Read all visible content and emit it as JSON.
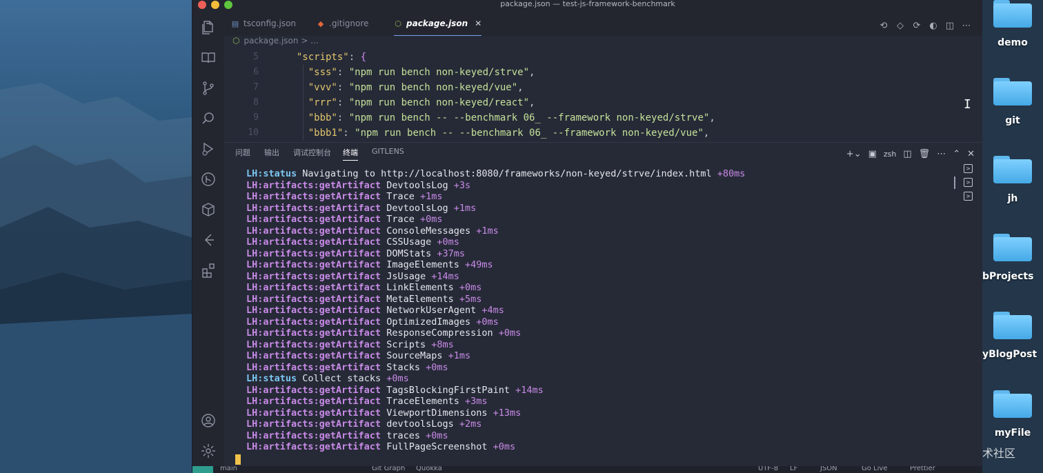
{
  "window": {
    "title": "package.json — test-js-framework-benchmark"
  },
  "tabs": [
    {
      "label": "tsconfig.json",
      "icon": "ts-config-icon",
      "active": false
    },
    {
      "label": ".gitignore",
      "icon": "git-icon",
      "active": false
    },
    {
      "label": "package.json",
      "icon": "node-json-icon",
      "active": true
    }
  ],
  "breadcrumb": {
    "file": "package.json",
    "sep": " > ..."
  },
  "editor": {
    "lines": [
      {
        "num": "5",
        "parts": [
          [
            "p",
            "  "
          ],
          [
            "k",
            "\"scripts\""
          ],
          [
            "p",
            ": "
          ],
          [
            "b",
            "{"
          ]
        ]
      },
      {
        "num": "6",
        "parts": [
          [
            "p",
            "    "
          ],
          [
            "k",
            "\"sss\""
          ],
          [
            "p",
            ": "
          ],
          [
            "s",
            "\"npm run bench non-keyed/strve\""
          ],
          [
            "p",
            ","
          ]
        ]
      },
      {
        "num": "7",
        "parts": [
          [
            "p",
            "    "
          ],
          [
            "k",
            "\"vvv\""
          ],
          [
            "p",
            ": "
          ],
          [
            "s",
            "\"npm run bench non-keyed/vue\""
          ],
          [
            "p",
            ","
          ]
        ]
      },
      {
        "num": "8",
        "parts": [
          [
            "p",
            "    "
          ],
          [
            "k",
            "\"rrr\""
          ],
          [
            "p",
            ": "
          ],
          [
            "s",
            "\"npm run bench non-keyed/react\""
          ],
          [
            "p",
            ","
          ]
        ]
      },
      {
        "num": "9",
        "parts": [
          [
            "p",
            "    "
          ],
          [
            "k",
            "\"bbb\""
          ],
          [
            "p",
            ": "
          ],
          [
            "s",
            "\"npm run bench -- --benchmark 06_ --framework non-keyed/strve\""
          ],
          [
            "p",
            ","
          ]
        ]
      },
      {
        "num": "10",
        "parts": [
          [
            "p",
            "    "
          ],
          [
            "k",
            "\"bbb1\""
          ],
          [
            "p",
            ": "
          ],
          [
            "s",
            "\"npm run bench -- --benchmark 06_ --framework non-keyed/vue\""
          ],
          [
            "p",
            ","
          ]
        ]
      }
    ]
  },
  "panel": {
    "tabs": [
      "问题",
      "输出",
      "调试控制台",
      "终端",
      "GITLENS"
    ],
    "active_tab": "终端",
    "shell": "zsh"
  },
  "terminal": {
    "lines": [
      {
        "tag": "LH:status",
        "text": " Navigating to http://localhost:8080/frameworks/non-keyed/strve/index.html",
        "time": " +80ms",
        "kind": "status"
      },
      {
        "tag": "LH:artifacts:getArtifact",
        "text": " DevtoolsLog",
        "time": " +3s",
        "kind": "artifact"
      },
      {
        "tag": "LH:artifacts:getArtifact",
        "text": " Trace",
        "time": " +1ms",
        "kind": "artifact"
      },
      {
        "tag": "LH:artifacts:getArtifact",
        "text": " DevtoolsLog",
        "time": " +1ms",
        "kind": "artifact"
      },
      {
        "tag": "LH:artifacts:getArtifact",
        "text": " Trace",
        "time": " +0ms",
        "kind": "artifact"
      },
      {
        "tag": "LH:artifacts:getArtifact",
        "text": " ConsoleMessages",
        "time": " +1ms",
        "kind": "artifact"
      },
      {
        "tag": "LH:artifacts:getArtifact",
        "text": " CSSUsage",
        "time": " +0ms",
        "kind": "artifact"
      },
      {
        "tag": "LH:artifacts:getArtifact",
        "text": " DOMStats",
        "time": " +37ms",
        "kind": "artifact"
      },
      {
        "tag": "LH:artifacts:getArtifact",
        "text": " ImageElements",
        "time": " +49ms",
        "kind": "artifact"
      },
      {
        "tag": "LH:artifacts:getArtifact",
        "text": " JsUsage",
        "time": " +14ms",
        "kind": "artifact"
      },
      {
        "tag": "LH:artifacts:getArtifact",
        "text": " LinkElements",
        "time": " +0ms",
        "kind": "artifact"
      },
      {
        "tag": "LH:artifacts:getArtifact",
        "text": " MetaElements",
        "time": " +5ms",
        "kind": "artifact"
      },
      {
        "tag": "LH:artifacts:getArtifact",
        "text": " NetworkUserAgent",
        "time": " +4ms",
        "kind": "artifact"
      },
      {
        "tag": "LH:artifacts:getArtifact",
        "text": " OptimizedImages",
        "time": " +0ms",
        "kind": "artifact"
      },
      {
        "tag": "LH:artifacts:getArtifact",
        "text": " ResponseCompression",
        "time": " +0ms",
        "kind": "artifact"
      },
      {
        "tag": "LH:artifacts:getArtifact",
        "text": " Scripts",
        "time": " +8ms",
        "kind": "artifact"
      },
      {
        "tag": "LH:artifacts:getArtifact",
        "text": " SourceMaps",
        "time": " +1ms",
        "kind": "artifact"
      },
      {
        "tag": "LH:artifacts:getArtifact",
        "text": " Stacks",
        "time": " +0ms",
        "kind": "artifact"
      },
      {
        "tag": "LH:status",
        "text": " Collect stacks",
        "time": " +0ms",
        "kind": "status"
      },
      {
        "tag": "LH:artifacts:getArtifact",
        "text": " TagsBlockingFirstPaint",
        "time": " +14ms",
        "kind": "artifact"
      },
      {
        "tag": "LH:artifacts:getArtifact",
        "text": " TraceElements",
        "time": " +3ms",
        "kind": "artifact"
      },
      {
        "tag": "LH:artifacts:getArtifact",
        "text": " ViewportDimensions",
        "time": " +13ms",
        "kind": "artifact"
      },
      {
        "tag": "LH:artifacts:getArtifact",
        "text": " devtoolsLogs",
        "time": " +2ms",
        "kind": "artifact"
      },
      {
        "tag": "LH:artifacts:getArtifact",
        "text": " traces",
        "time": " +0ms",
        "kind": "artifact"
      },
      {
        "tag": "LH:artifacts:getArtifact",
        "text": " FullPageScreenshot",
        "time": " +0ms",
        "kind": "artifact"
      }
    ]
  },
  "desktop": {
    "icons": [
      {
        "label": "demo"
      },
      {
        "label": "git"
      },
      {
        "label": "jh"
      },
      {
        "label": "bProjects"
      },
      {
        "label": "yBlogPost"
      },
      {
        "label": "myFile"
      }
    ],
    "watermark": "@稀土掘金技术社区"
  },
  "statusbar": {
    "items": [
      "main",
      "Git Graph",
      "Quokka",
      "UTF-8",
      "LF",
      "JSON",
      "Go Live",
      "Prettier"
    ]
  },
  "colors": {
    "window_bg": "#262a37",
    "accent": "#7aa2f7",
    "log_tag": "#c98be8",
    "status_tag": "#7cc7f2",
    "json_key": "#e2c66d",
    "json_string": "#c5e19a"
  }
}
